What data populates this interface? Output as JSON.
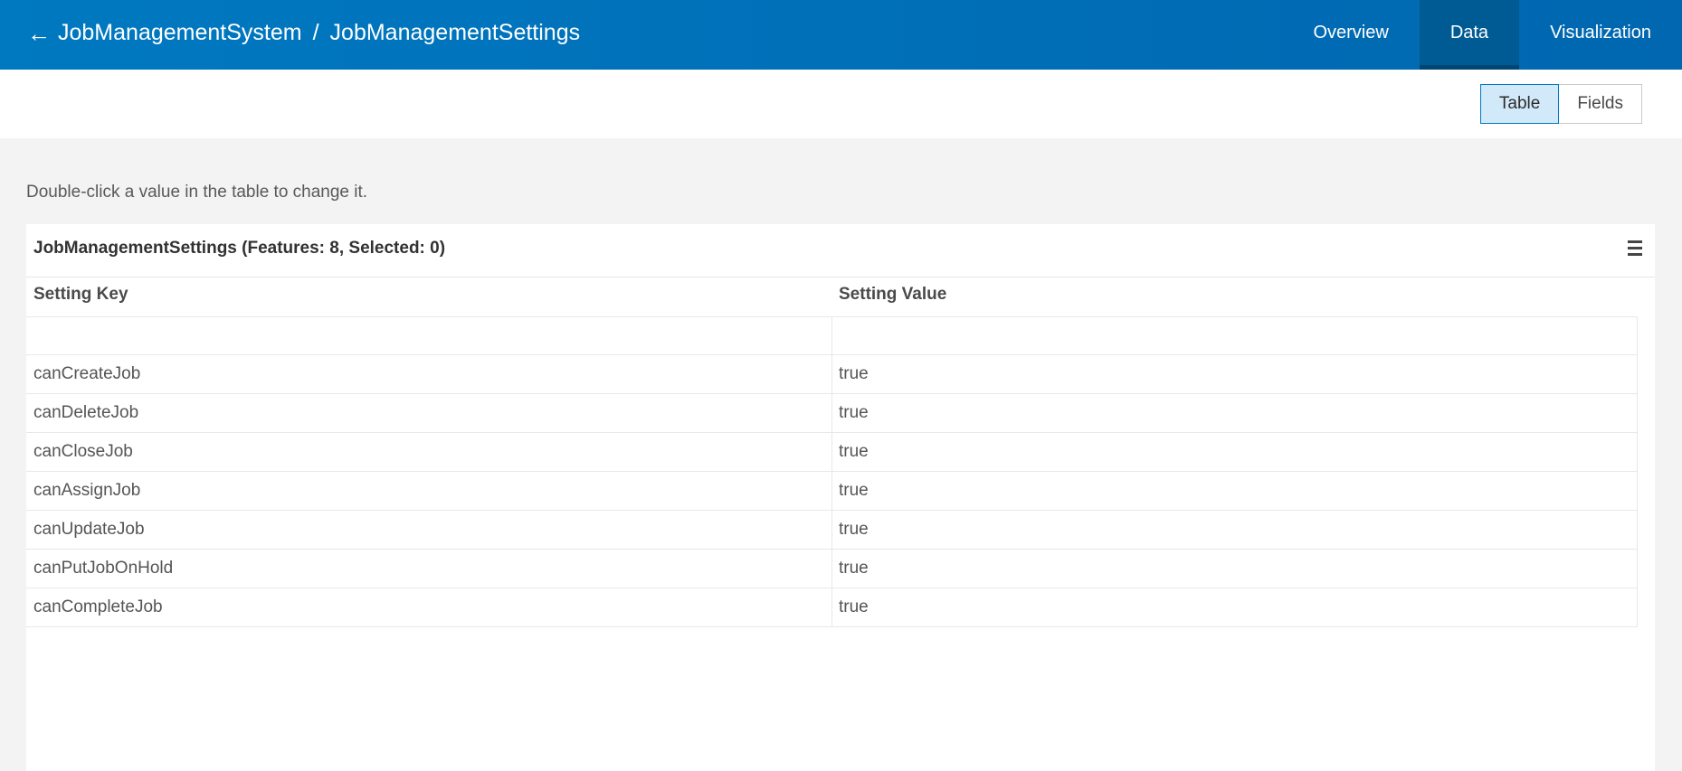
{
  "header": {
    "breadcrumb": [
      "JobManagementSystem",
      "JobManagementSettings"
    ],
    "separator": "/",
    "back_icon": "arrow-left-icon",
    "nav": [
      {
        "label": "Overview",
        "active": false
      },
      {
        "label": "Data",
        "active": true
      },
      {
        "label": "Visualization",
        "active": false
      }
    ],
    "colors": {
      "primary": "#0079c1",
      "active_tab": "#005a94"
    }
  },
  "view_toggle": {
    "options": [
      "Table",
      "Fields"
    ],
    "selected": "Table"
  },
  "hint": "Double-click a value in the table to change it.",
  "table": {
    "title": "JobManagementSettings (Features: 8, Selected: 0)",
    "menu_icon": "hamburger-menu-icon",
    "columns": [
      "Setting Key",
      "Setting Value"
    ],
    "rows": [
      [
        "",
        ""
      ],
      [
        "canCreateJob",
        "true"
      ],
      [
        "canDeleteJob",
        "true"
      ],
      [
        "canCloseJob",
        "true"
      ],
      [
        "canAssignJob",
        "true"
      ],
      [
        "canUpdateJob",
        "true"
      ],
      [
        "canPutJobOnHold",
        "true"
      ],
      [
        "canCompleteJob",
        "true"
      ]
    ]
  }
}
